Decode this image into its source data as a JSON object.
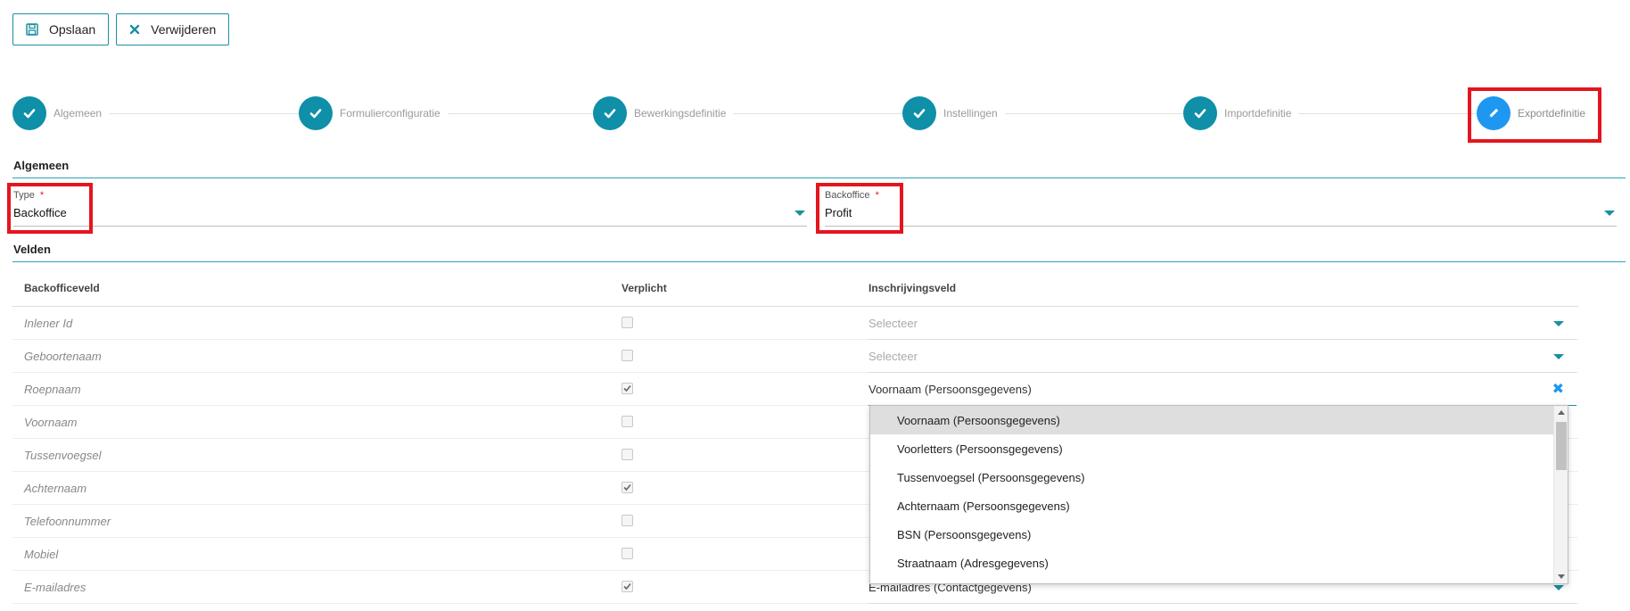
{
  "toolbar": {
    "save_label": "Opslaan",
    "delete_label": "Verwijderen",
    "save_icon": "floppy-disk-icon",
    "delete_icon": "close-icon"
  },
  "stepper": {
    "steps": [
      {
        "label": "Algemeen",
        "state": "done"
      },
      {
        "label": "Formulierconfiguratie",
        "state": "done"
      },
      {
        "label": "Bewerkingsdefinitie",
        "state": "done"
      },
      {
        "label": "Instellingen",
        "state": "done"
      },
      {
        "label": "Importdefinitie",
        "state": "done"
      },
      {
        "label": "Exportdefinitie",
        "state": "active"
      }
    ]
  },
  "algemeen": {
    "section_title": "Algemeen",
    "type_label": "Type",
    "type_required": "*",
    "type_value": "Backoffice",
    "backoffice_label": "Backoffice",
    "backoffice_required": "*",
    "backoffice_value": "Profit"
  },
  "velden": {
    "section_title": "Velden",
    "columns": {
      "backofficeveld": "Backofficeveld",
      "verplicht": "Verplicht",
      "inschrijvingsveld": "Inschrijvingsveld"
    },
    "rows": [
      {
        "name": "Inlener Id",
        "required": false,
        "value": "Selecteer",
        "placeholder": true
      },
      {
        "name": "Geboortenaam",
        "required": false,
        "value": "Selecteer",
        "placeholder": true
      },
      {
        "name": "Roepnaam",
        "required": true,
        "value": "Voornaam (Persoonsgegevens)",
        "placeholder": false,
        "clearable": true
      },
      {
        "name": "Voornaam",
        "required": false,
        "value": "",
        "placeholder": false
      },
      {
        "name": "Tussenvoegsel",
        "required": false,
        "value": "",
        "placeholder": false
      },
      {
        "name": "Achternaam",
        "required": true,
        "value": "",
        "placeholder": false
      },
      {
        "name": "Telefoonnummer",
        "required": false,
        "value": "",
        "placeholder": false
      },
      {
        "name": "Mobiel",
        "required": false,
        "value": "",
        "placeholder": false
      },
      {
        "name": "E-mailadres",
        "required": true,
        "value": "E-mailadres (Contactgegevens)",
        "placeholder": false
      }
    ]
  },
  "dropdown": {
    "options": [
      "Voornaam (Persoonsgegevens)",
      "Voorletters (Persoonsgegevens)",
      "Tussenvoegsel (Persoonsgegevens)",
      "Achternaam (Persoonsgegevens)",
      "BSN (Persoonsgegevens)",
      "Straatnaam (Adresgegevens)"
    ],
    "highlighted_index": 0
  },
  "colors": {
    "accent": "#0f8fa8",
    "active_step": "#1e97f0",
    "annotation_red": "#e4151e"
  }
}
